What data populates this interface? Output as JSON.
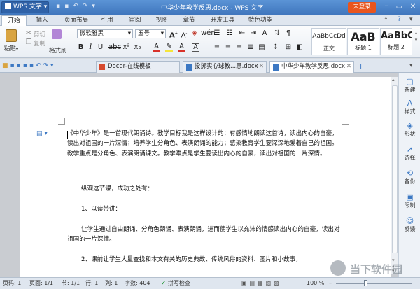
{
  "title_bar": {
    "app_name": "WPS 文字",
    "doc_title": "中华少年教学反思.docx - WPS 文字",
    "login_button": "未登录",
    "icon_close": "close-icon",
    "icon_max": "maximize-icon",
    "icon_min": "minimize-icon"
  },
  "menu_tabs": [
    "开始",
    "插入",
    "页面布局",
    "引用",
    "审阅",
    "视图",
    "章节",
    "开发工具",
    "特色功能"
  ],
  "ribbon": {
    "paste": "粘贴",
    "cut": "剪切",
    "copy": "复制",
    "format_painter": "格式刷",
    "font_name": "微软雅黑",
    "font_size": "五号",
    "styles": [
      {
        "preview": "AaBbCcDd",
        "name": "正文"
      },
      {
        "preview": "AaB",
        "name": "标题 1"
      },
      {
        "preview": "AaBbC(",
        "name": "标题 2"
      }
    ]
  },
  "doc_tabs": [
    "Docer-在线模板",
    "投掷实心球教...思.docx",
    "中华少年教学反思.docx"
  ],
  "document": {
    "paragraphs": [
      "《中华少年》是一首现代朗诵诗。教学目标我是这样设计的：有感情地朗读这首诗，读出内心的自豪，读出对祖国的一片深情；培养学生分角色、表演朗诵的能力；感染教育学生要深深地爱着自己的祖国。教学重点是分角色、表演朗诵课文。教学难点是学生要读出内心的自豪，读出对祖国的一片深情。",
      "纵观这节课，成功之处有：",
      "1、以读带讲：",
      "让学生通过自由朗诵、分角色朗诵、表演朗诵，进而使学生以充沛的情感读出内心的自豪，读出对祖国的一片深情。",
      "2、课前让学生大量查找和本文有关的历史典故、传统风俗的资料、图片和小故事，"
    ]
  },
  "sidebar": [
    "新建",
    "样式",
    "形状",
    "选择",
    "备份",
    "限制",
    "反馈"
  ],
  "status_bar": {
    "page_num": "页码: 1",
    "pages": "页面: 1/1",
    "section": "节: 1/1",
    "row": "行: 1",
    "col": "列: 1",
    "word_count": "字数: 404",
    "spell_check": "拼写检查",
    "zoom": "100 %"
  },
  "watermark": "当下软件园"
}
